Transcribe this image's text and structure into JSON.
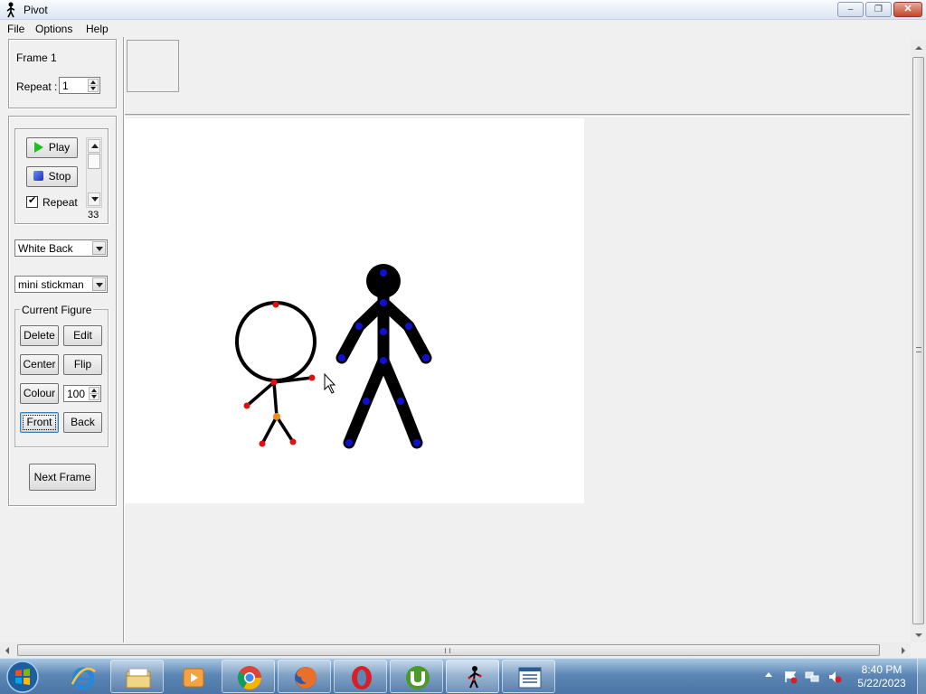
{
  "window": {
    "title": "Pivot",
    "minimize_glyph": "–",
    "maximize_glyph": "❐",
    "close_glyph": "✕"
  },
  "menu": [
    "File",
    "Options",
    "Help"
  ],
  "frame_panel": {
    "frame_label": "Frame 1",
    "repeat_label": "Repeat :",
    "repeat_value": "1"
  },
  "playback": {
    "play_label": "Play",
    "stop_label": "Stop",
    "repeat_checkbox_label": "Repeat",
    "repeat_checked": true,
    "speed_value": "33"
  },
  "background_select": {
    "value": "White Back"
  },
  "figure_select": {
    "value": "mini stickman"
  },
  "current_figure": {
    "legend": "Current Figure",
    "delete_label": "Delete",
    "edit_label": "Edit",
    "center_label": "Center",
    "flip_label": "Flip",
    "colour_label": "Colour",
    "colour_value": "100",
    "front_label": "Front",
    "back_label": "Back"
  },
  "next_frame_label": "Next Frame",
  "colors": {
    "handle_red": "#e01010",
    "handle_orange": "#f08a1a",
    "handle_blue": "#1010d0",
    "figure_black": "#000000"
  },
  "taskbar": {
    "apps": [
      "internet-explorer",
      "windows-explorer",
      "media-player",
      "chrome",
      "firefox",
      "opera",
      "utorrent",
      "pivot",
      "task-list"
    ],
    "time": "8:40 PM",
    "date": "5/22/2023"
  }
}
